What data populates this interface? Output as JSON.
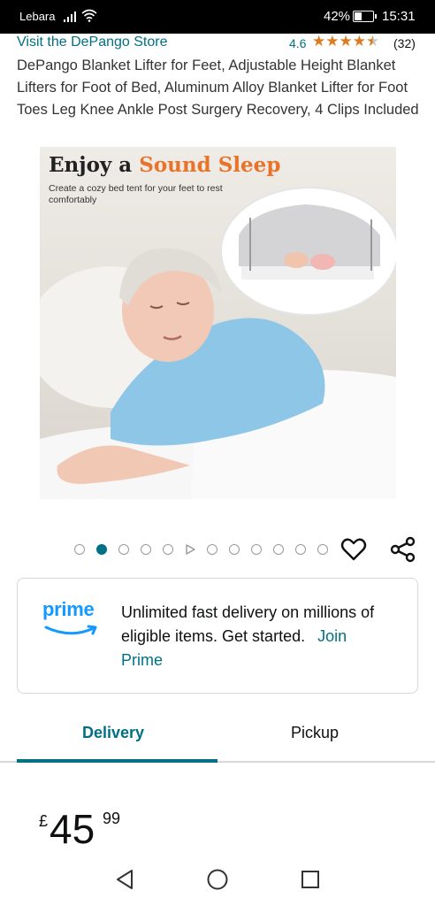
{
  "status_bar": {
    "carrier": "Lebara",
    "battery_percent": "42%",
    "battery_level": 0.42,
    "time": "15:31"
  },
  "product": {
    "store_link": "Visit the DePango Store",
    "rating": "4.6",
    "rating_value": 4.6,
    "review_count": "(32)",
    "title": "DePango Blanket Lifter for Feet, Adjustable Height Blanket Lifters for Foot of Bed, Aluminum Alloy Blanket Lifter for Foot Toes Leg Knee Ankle Post Surgery Recovery, 4 Clips Included"
  },
  "hero_image": {
    "headline_part1": "Enjoy a",
    "headline_part2": "Sound Sleep",
    "subtext": "Create a cozy bed tent for your feet to rest comfortably"
  },
  "carousel": {
    "total_items": 12,
    "active_index": 1,
    "video_index": 5
  },
  "prime": {
    "logo": "prime",
    "message": "Unlimited fast delivery on millions of eligible items. Get started.",
    "link": "Join Prime"
  },
  "tabs": [
    {
      "label": "Delivery",
      "active": true
    },
    {
      "label": "Pickup",
      "active": false
    }
  ],
  "price": {
    "symbol": "£",
    "whole": "45",
    "fraction": "99"
  },
  "colors": {
    "link": "#007185",
    "star": "#DE7921",
    "prime_blue": "#1399FF",
    "headline_orange": "#E8742B"
  },
  "icons": {
    "heart": "heart-icon",
    "share": "share-icon",
    "back": "back-triangle-icon",
    "home": "home-circle-icon",
    "recents": "recents-square-icon"
  }
}
